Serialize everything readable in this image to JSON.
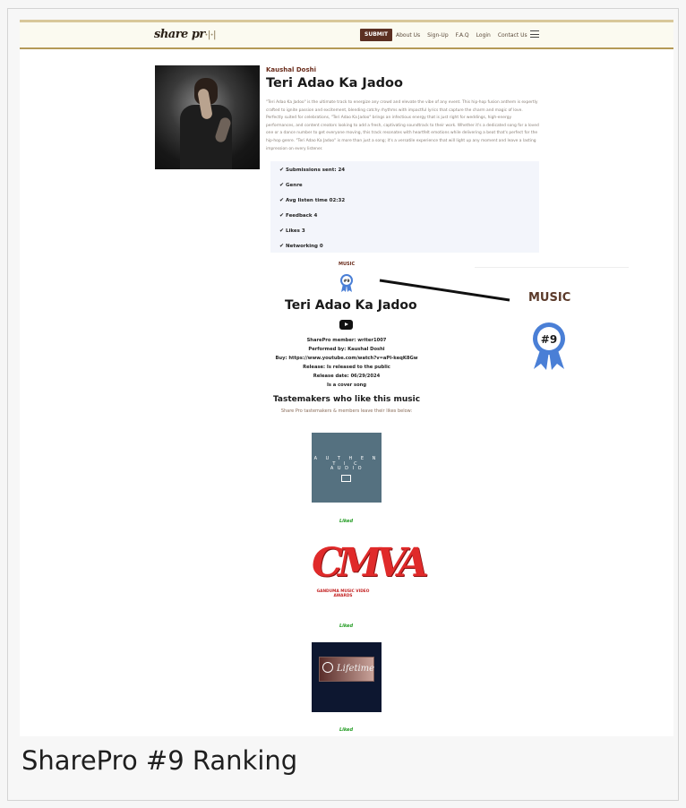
{
  "header": {
    "logo_text": "share pr",
    "logo_suffix": "·|·|",
    "submit_label": "SUBMIT",
    "nav_links": [
      "About Us",
      "Sign-Up",
      "F.A.Q",
      "Login",
      "Contact Us"
    ]
  },
  "track": {
    "artist": "Kaushal Doshi",
    "title": "Teri Adao Ka Jadoo",
    "description": "\"Teri Adao Ka Jadoo\" is the ultimate track to energize any crowd and elevate the vibe of any event. This hip-hop fusion anthem is expertly crafted to ignite passion and excitement, blending catchy rhythms with impactful lyrics that capture the charm and magic of love. Perfectly suited for celebrations, \"Teri Adao Ka Jadoo\" brings an infectious energy that is just right for weddings, high-energy performances, and content creators looking to add a fresh, captivating soundtrack to their work. Whether it's a dedicated song for a loved one or a dance number to get everyone moving, this track resonates with heartfelt emotions while delivering a beat that's perfect for the hip-hop genre. \"Teri Adao Ka Jadoo\" is more than just a song; it's a versatile experience that will light up any moment and leave a lasting impression on every listener."
  },
  "stats": [
    "Submissions sent: 24",
    "Genre",
    "Avg listen time 02:32",
    "Feedback 4",
    "Likes 3",
    "Networking 0"
  ],
  "ranking": {
    "category": "MUSIC",
    "rank": "#9"
  },
  "details": {
    "member": "SharePro member: writer1007",
    "performed_by": "Performed by: Kaushal Doshi",
    "buy": "Buy: https://www.youtube.com/watch?v=aPI-keqK8Gw",
    "release": "Release: Is released to the public",
    "release_date": "Release date: 06/29/2024",
    "cover": "Is a cover song"
  },
  "tastemakers": {
    "title": "Tastemakers who like this music",
    "subtitle": "Share Pro tastemakers & members leave their likes below:",
    "cards": [
      {
        "line1": "A U T H E N T I C",
        "line2": "A U D I O",
        "liked": "Liked"
      },
      {
        "line1": "CMVA",
        "line2": "GANDUMA MUSIC VIDEO AWARDS",
        "liked": "Liked"
      },
      {
        "line1": "Lifetime",
        "liked": "Liked"
      }
    ]
  },
  "caption": "SharePro #9 Ranking",
  "colors": {
    "accent": "#5b2f22",
    "liked": "#1f9a1f",
    "badge": "#4a7fd6"
  }
}
